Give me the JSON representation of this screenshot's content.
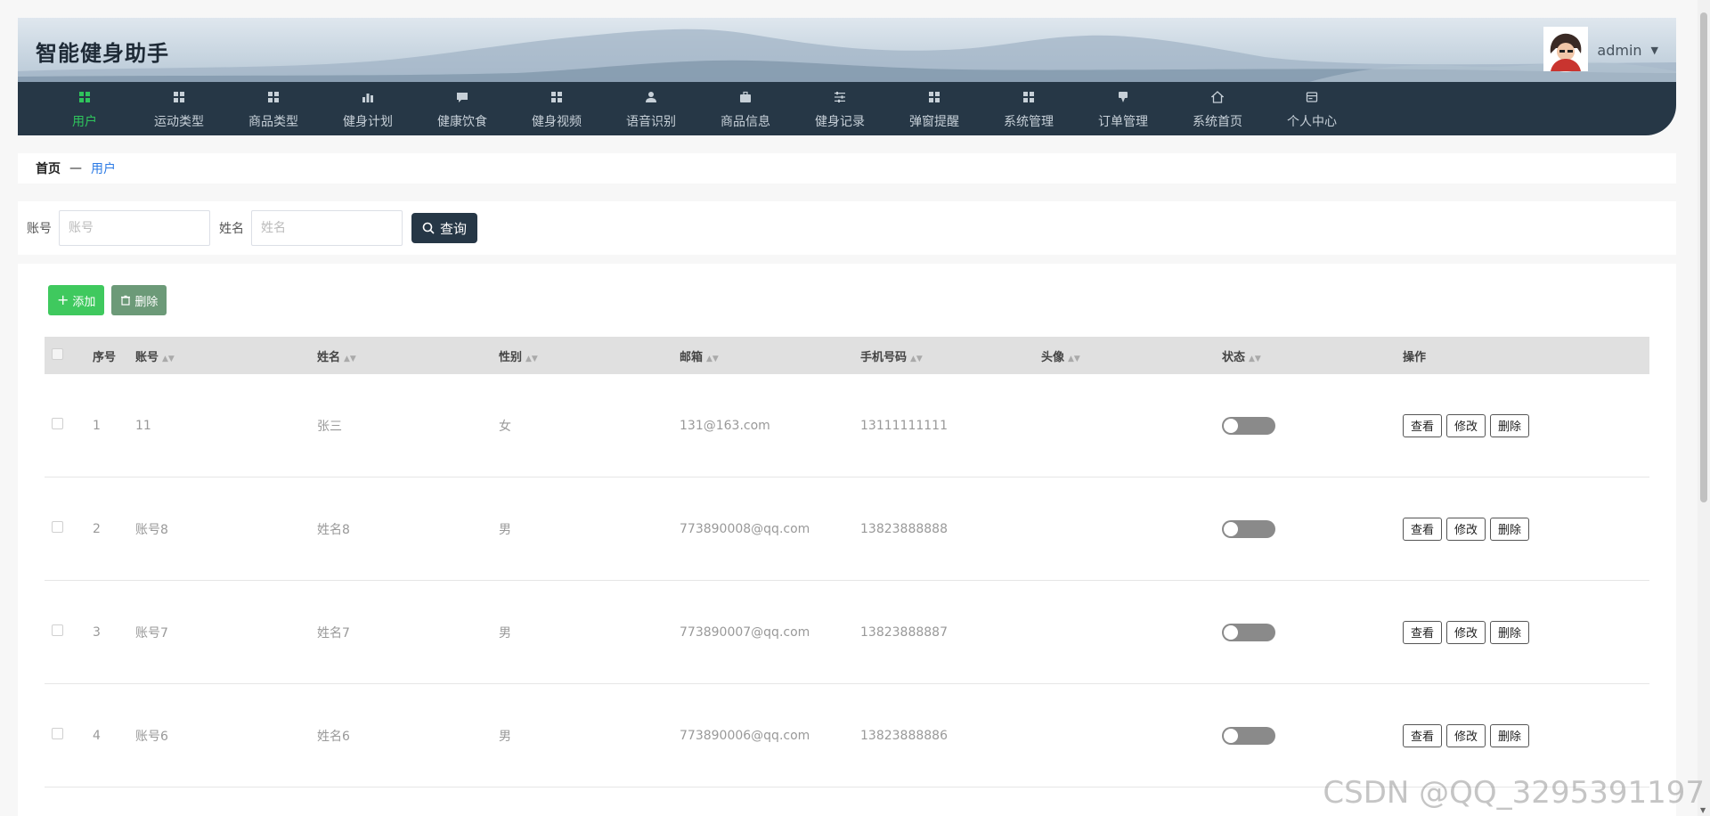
{
  "header": {
    "site_title": "智能健身助手",
    "username": "admin",
    "caret": "▼"
  },
  "nav": [
    {
      "label": "用户",
      "icon": "grid-icon",
      "active": true
    },
    {
      "label": "运动类型",
      "icon": "grid-icon"
    },
    {
      "label": "商品类型",
      "icon": "grid-icon"
    },
    {
      "label": "健身计划",
      "icon": "bar-chart-icon"
    },
    {
      "label": "健康饮食",
      "icon": "chat-icon"
    },
    {
      "label": "健身视频",
      "icon": "grid-icon"
    },
    {
      "label": "语音识别",
      "icon": "person-icon"
    },
    {
      "label": "商品信息",
      "icon": "briefcase-icon"
    },
    {
      "label": "健身记录",
      "icon": "sliders-icon"
    },
    {
      "label": "弹窗提醒",
      "icon": "grid-icon"
    },
    {
      "label": "系统管理",
      "icon": "grid-icon"
    },
    {
      "label": "订单管理",
      "icon": "pin-icon"
    },
    {
      "label": "系统首页",
      "icon": "home-icon"
    },
    {
      "label": "个人中心",
      "icon": "window-icon"
    }
  ],
  "breadcrumb": {
    "home": "首页",
    "separator": "—",
    "current": "用户"
  },
  "search": {
    "account_label": "账号",
    "account_placeholder": "账号",
    "name_label": "姓名",
    "name_placeholder": "姓名",
    "query_button": "查询"
  },
  "actions": {
    "add": "添加",
    "delete": "删除"
  },
  "table": {
    "headers": [
      "序号",
      "账号",
      "姓名",
      "性别",
      "邮箱",
      "手机号码",
      "头像",
      "状态",
      "操作"
    ],
    "rows": [
      {
        "idx": "1",
        "account": "11",
        "name": "张三",
        "sex": "女",
        "email": "131@163.com",
        "phone": "13111111111",
        "enabled": false
      },
      {
        "idx": "2",
        "account": "账号8",
        "name": "姓名8",
        "sex": "男",
        "email": "773890008@qq.com",
        "phone": "13823888888",
        "enabled": false
      },
      {
        "idx": "3",
        "account": "账号7",
        "name": "姓名7",
        "sex": "男",
        "email": "773890007@qq.com",
        "phone": "13823888887",
        "enabled": false
      },
      {
        "idx": "4",
        "account": "账号6",
        "name": "姓名6",
        "sex": "男",
        "email": "773890006@qq.com",
        "phone": "13823888886",
        "enabled": false
      }
    ],
    "row_actions": {
      "view": "查看",
      "edit": "修改",
      "delete": "删除"
    }
  },
  "watermark": "CSDN @QQ_3295391197",
  "colors": {
    "nav_bg": "#263746",
    "active": "#2fc45c",
    "add_button": "#3fc95e",
    "delete_button": "#6c9a78",
    "link": "#2c7be5"
  }
}
